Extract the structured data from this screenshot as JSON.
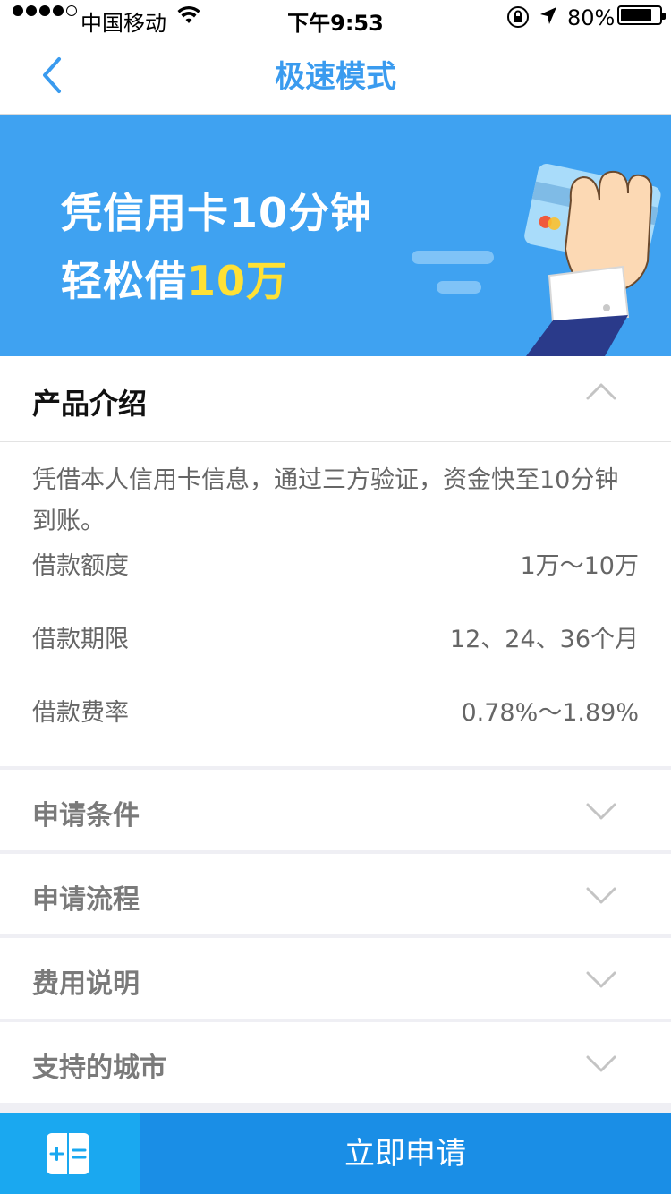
{
  "status_bar": {
    "carrier": "中国移动",
    "time": "下午9:53",
    "battery": "80%"
  },
  "nav": {
    "title": "极速模式",
    "back_icon": "chevron-left-icon"
  },
  "banner": {
    "line1": "凭信用卡10分钟",
    "line2_prefix": "轻松借",
    "line2_highlight": "10万",
    "highlight_color": "#ffe135"
  },
  "intro": {
    "title": "产品介绍",
    "description": "凭借本人信用卡信息，通过三方验证，资金快至10分钟到账。",
    "rows": [
      {
        "label": "借款额度",
        "value": "1万～10万"
      },
      {
        "label": "借款期限",
        "value": "12、24、36个月"
      },
      {
        "label": "借款费率",
        "value": "0.78%～1.89%"
      }
    ]
  },
  "sections": [
    {
      "label": "申请条件"
    },
    {
      "label": "申请流程"
    },
    {
      "label": "费用说明"
    },
    {
      "label": "支持的城市"
    }
  ],
  "bottom": {
    "apply_label": "立即申请",
    "cs_icon": "calculator-icon"
  },
  "colors": {
    "accent": "#3a9bef",
    "banner_bg": "#3fa2f1",
    "apply_bg": "#1a8ee6",
    "cs_bg": "#1aa8f0"
  }
}
